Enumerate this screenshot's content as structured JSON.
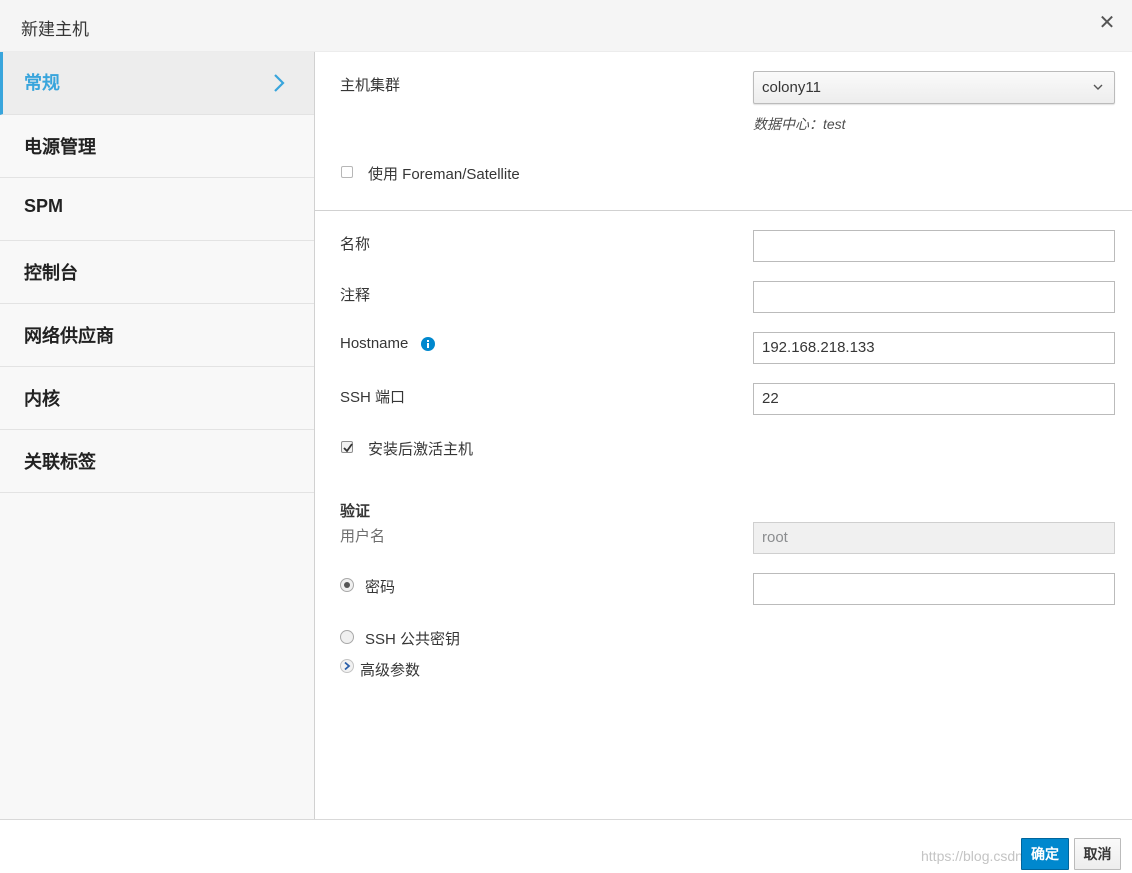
{
  "dialog": {
    "title": "新建主机"
  },
  "sidebar": {
    "items": [
      {
        "label": "常规",
        "active": true
      },
      {
        "label": "电源管理"
      },
      {
        "label": "SPM"
      },
      {
        "label": "控制台"
      },
      {
        "label": "网络供应商"
      },
      {
        "label": "内核"
      },
      {
        "label": "关联标签"
      }
    ]
  },
  "form": {
    "cluster_label": "主机集群",
    "cluster_value": "colony11",
    "datacenter_text": "数据中心：test",
    "foreman_label": "使用 Foreman/Satellite",
    "name_label": "名称",
    "name_value": "",
    "comment_label": "注释",
    "comment_value": "",
    "hostname_label": "Hostname",
    "hostname_value": "192.168.218.133",
    "ssh_port_label": "SSH 端口",
    "ssh_port_value": "22",
    "activate_label": "安装后激活主机",
    "auth_heading": "验证",
    "username_label": "用户名",
    "username_value": "root",
    "password_label": "密码",
    "password_value": "",
    "ssh_key_label": "SSH 公共密钥",
    "advanced_label": "高级参数"
  },
  "footer": {
    "ok_label": "确定",
    "cancel_label": "取消",
    "watermark": "https://blog.csdn.net/..."
  },
  "colors": {
    "accent": "#39a5dc",
    "primary_button": "#0088ce"
  },
  "icons": [
    "close-icon",
    "chevron-right-icon",
    "caret-down-icon",
    "info-icon",
    "expand-arrow-icon",
    "checkmark-icon"
  ]
}
